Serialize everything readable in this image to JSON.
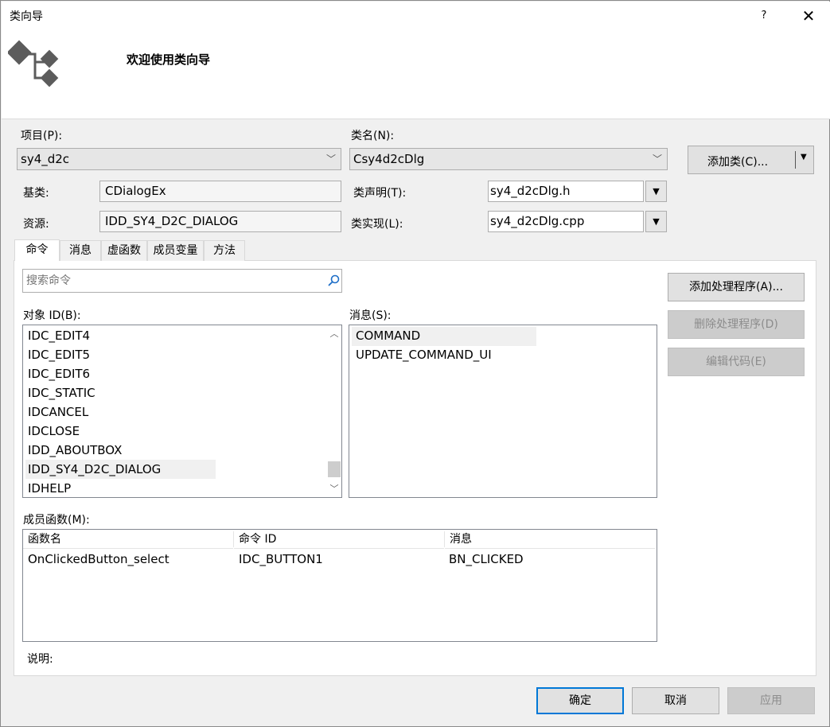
{
  "window": {
    "title": "类向导",
    "help": "?",
    "close": "✕"
  },
  "header": {
    "welcome": "欢迎使用类向导"
  },
  "project": {
    "label": "项目(P):",
    "value": "sy4_d2c"
  },
  "classname": {
    "label": "类名(N):",
    "value": "Csy4d2cDlg"
  },
  "add_class": {
    "label": "添加类(C)..."
  },
  "base": {
    "label": "基类:",
    "value": "CDialogEx"
  },
  "resource": {
    "label": "资源:",
    "value": "IDD_SY4_D2C_DIALOG"
  },
  "decl": {
    "label": "类声明(T):",
    "value": "sy4_d2cDlg.h"
  },
  "impl": {
    "label": "类实现(L):",
    "value": "sy4_d2cDlg.cpp"
  },
  "tabs": [
    {
      "label": "命令"
    },
    {
      "label": "消息"
    },
    {
      "label": "虚函数"
    },
    {
      "label": "成员变量"
    },
    {
      "label": "方法"
    }
  ],
  "search": {
    "placeholder": "搜索命令"
  },
  "object_ids": {
    "label": "对象 ID(B):",
    "items": [
      "IDC_EDIT4",
      "IDC_EDIT5",
      "IDC_EDIT6",
      "IDC_STATIC",
      "IDCANCEL",
      "IDCLOSE",
      "IDD_ABOUTBOX",
      "IDD_SY4_D2C_DIALOG",
      "IDHELP"
    ],
    "selected_index": 7
  },
  "messages": {
    "label": "消息(S):",
    "items": [
      "COMMAND",
      "UPDATE_COMMAND_UI"
    ],
    "selected_index": 0
  },
  "actions": {
    "add_handler": "添加处理程序(A)...",
    "delete_handler": "删除处理程序(D)",
    "edit_code": "编辑代码(E)"
  },
  "members": {
    "label": "成员函数(M):",
    "columns": [
      "函数名",
      "命令 ID",
      "消息"
    ],
    "rows": [
      [
        "OnClickedButton_select",
        "IDC_BUTTON1",
        "BN_CLICKED"
      ]
    ]
  },
  "description": {
    "label": "说明:"
  },
  "footer": {
    "ok": "确定",
    "cancel": "取消",
    "apply": "应用"
  },
  "colors": {
    "accent_border": "#0078d7",
    "disabled_text": "#8c8c8c"
  }
}
